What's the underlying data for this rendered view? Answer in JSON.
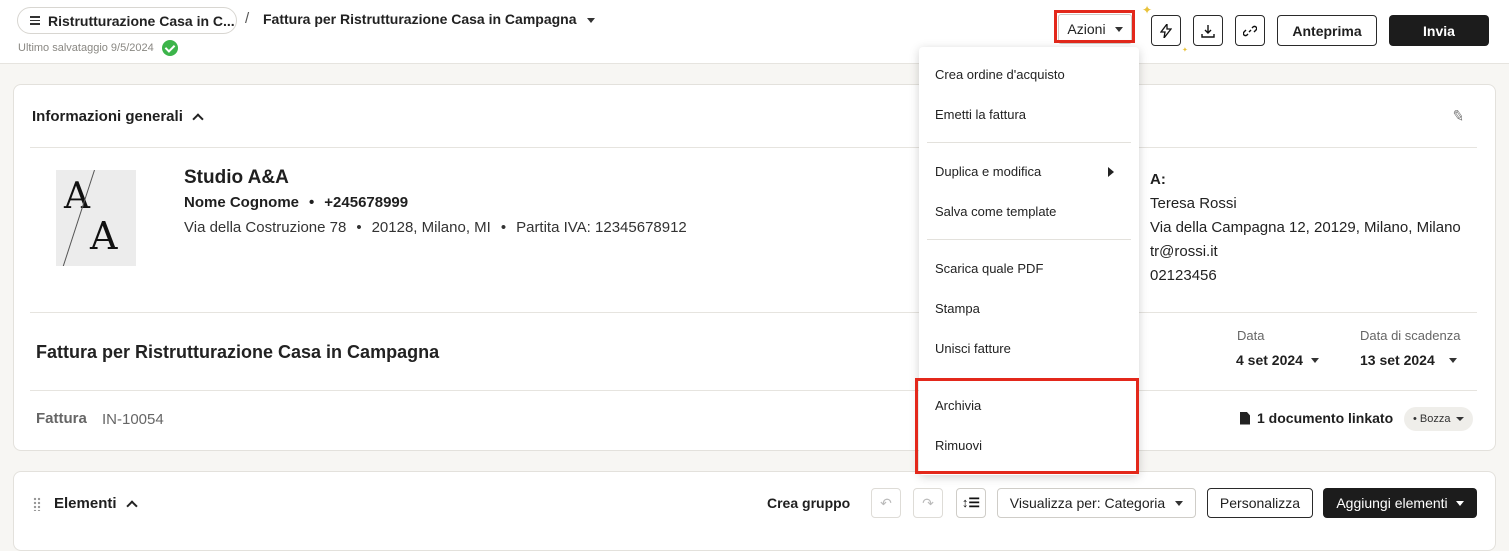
{
  "header": {
    "project_pill": "Ristrutturazione Casa in C...",
    "separator": "/",
    "doc_title": "Fattura per Ristrutturazione Casa in Campagna",
    "save_status": "Ultimo salvataggio 9/5/2024",
    "azioni_label": "Azioni",
    "anteprima_label": "Anteprima",
    "invia_label": "Invia"
  },
  "actions_menu": {
    "items": [
      "Crea ordine d'acquisto",
      "Emetti la fattura",
      "Duplica e modifica",
      "Salva come template",
      "Scarica quale PDF",
      "Stampa",
      "Unisci fatture",
      "Archivia",
      "Rimuovi"
    ]
  },
  "info": {
    "section_title": "Informazioni generali",
    "company": "Studio A&A",
    "contact_name": "Nome Cognome",
    "contact_phone": "+245678999",
    "street": "Via della Costruzione 78",
    "city": "20128, Milano, MI",
    "vat": "Partita IVA: 12345678912",
    "logo_letters": "A/A",
    "recipient_label": "A:",
    "recipient_name": "Teresa Rossi",
    "recipient_address": "Via della Campagna 12, 20129, Milano, Milano",
    "recipient_email": "tr@rossi.it",
    "recipient_phone": "02123456"
  },
  "invoice": {
    "title": "Fattura per Ristrutturazione Casa in Campagna",
    "date_label": "Data",
    "date_value": "4 set 2024",
    "due_label": "Data di scadenza",
    "due_value": "13 set 2024",
    "type_label": "Fattura",
    "number": "IN-10054",
    "linked_docs": "1 documento linkato",
    "status": "Bozza"
  },
  "elements": {
    "title": "Elementi",
    "crea_gruppo": "Crea gruppo",
    "view_by": "Visualizza per: Categoria",
    "personalizza": "Personalizza",
    "aggiungi": "Aggiungi elementi"
  },
  "colors": {
    "highlight": "#e3281b",
    "success": "#3cb44a",
    "primary_button": "#1c1c1c"
  }
}
